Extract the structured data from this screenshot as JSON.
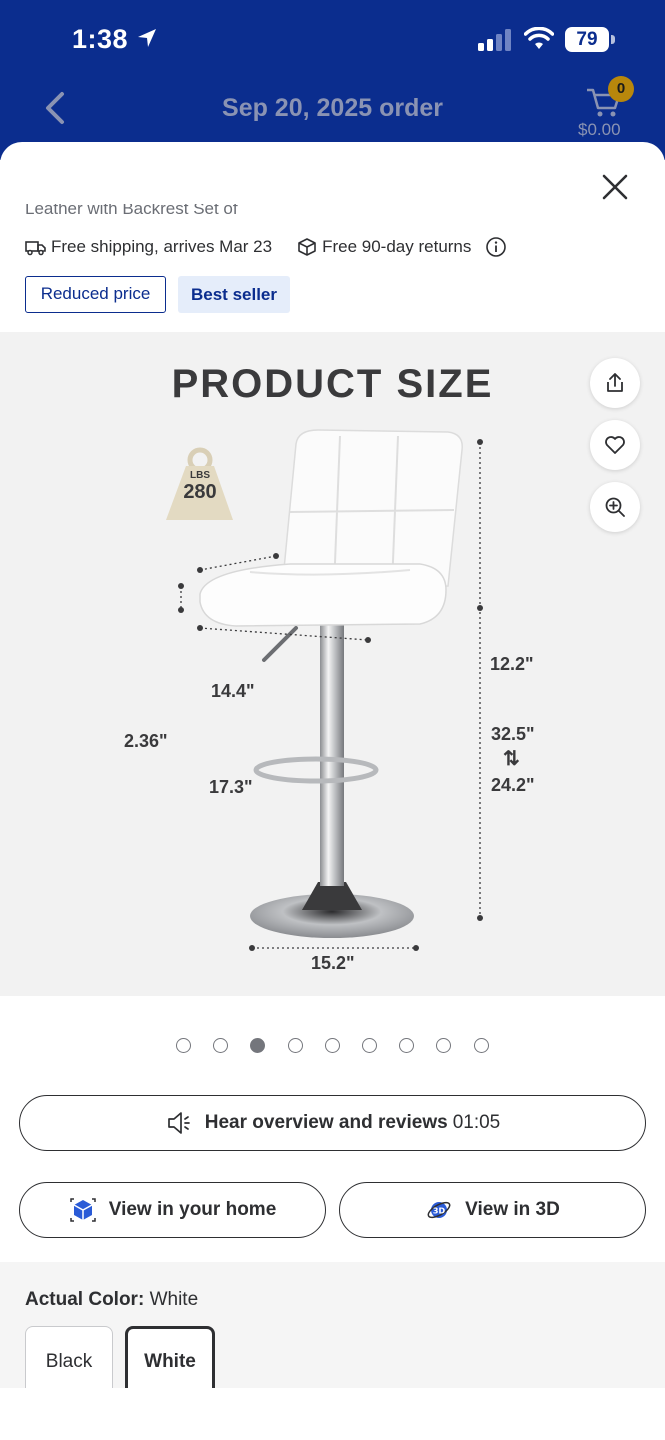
{
  "status_bar": {
    "time": "1:38",
    "battery": "79"
  },
  "header": {
    "title": "Sep 20, 2025 order",
    "cart_count": "0",
    "cart_total": "$0.00"
  },
  "sheet": {
    "cut_text": "Leather with Backrest Set of",
    "shipping": "Free shipping, arrives Mar 23",
    "returns": "Free 90-day returns",
    "badges": {
      "reduced": "Reduced price",
      "best_seller": "Best seller"
    }
  },
  "product_image": {
    "title": "PRODUCT SIZE",
    "weight_unit": "LBS",
    "weight_value": "280",
    "dimensions": {
      "back_height": "12.2\"",
      "seat_depth": "14.4\"",
      "seat_thickness": "2.36\"",
      "seat_width": "17.3\"",
      "height_max": "32.5\"",
      "height_min": "24.2\"",
      "base_diameter": "15.2\""
    },
    "actions": [
      "share-icon",
      "heart-icon",
      "zoom-in-icon"
    ]
  },
  "carousel": {
    "total": 9,
    "active_index": 2
  },
  "buttons": {
    "hear_label": "Hear overview and reviews",
    "hear_duration": "01:05",
    "view_home": "View in your home",
    "view_3d": "View in 3D"
  },
  "color": {
    "label": "Actual Color:",
    "value": "White",
    "options": [
      "Black",
      "White"
    ],
    "selected": "White"
  }
}
